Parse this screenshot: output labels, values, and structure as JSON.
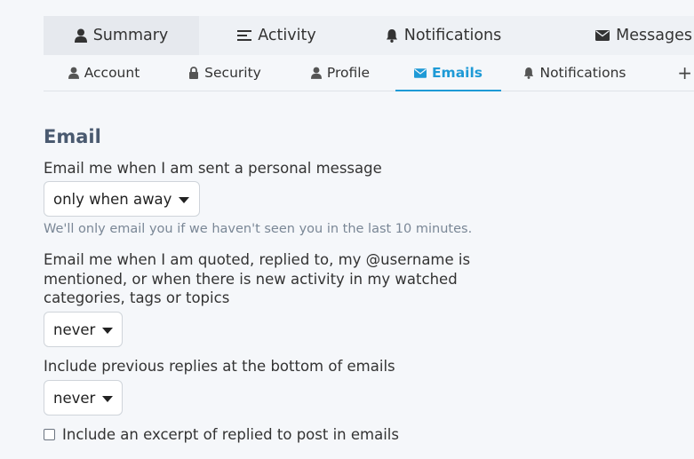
{
  "primary_nav": [
    {
      "label": "Summary",
      "icon": "user-icon",
      "active": true
    },
    {
      "label": "Activity",
      "icon": "list-icon",
      "active": false
    },
    {
      "label": "Notifications",
      "icon": "bell-icon",
      "active": false
    },
    {
      "label": "Messages",
      "icon": "envelope-icon",
      "active": false
    }
  ],
  "secondary_nav": [
    {
      "label": "Account",
      "icon": "user-icon"
    },
    {
      "label": "Security",
      "icon": "lock-icon"
    },
    {
      "label": "Profile",
      "icon": "user-icon"
    },
    {
      "label": "Emails",
      "icon": "envelope-icon",
      "active": true
    },
    {
      "label": "Notifications",
      "icon": "bell-icon"
    },
    {
      "label": "+",
      "icon": "plus-icon"
    }
  ],
  "email": {
    "title": "Email",
    "pm_label": "Email me when I am sent a personal message",
    "pm_value": "only when away",
    "pm_hint": "We'll only email you if we haven't seen you in the last 10 minutes.",
    "activity_label": "Email me when I am quoted, replied to, my @username is mentioned, or when there is new activity in my watched categories, tags or topics",
    "activity_value": "never",
    "previous_label": "Include previous replies at the bottom of emails",
    "previous_value": "never",
    "excerpt_label": "Include an excerpt of replied to post in emails",
    "excerpt_checked": false
  },
  "colors": {
    "accent": "#1e9ad6",
    "title": "#4a5a70",
    "hint": "#7a8796"
  }
}
